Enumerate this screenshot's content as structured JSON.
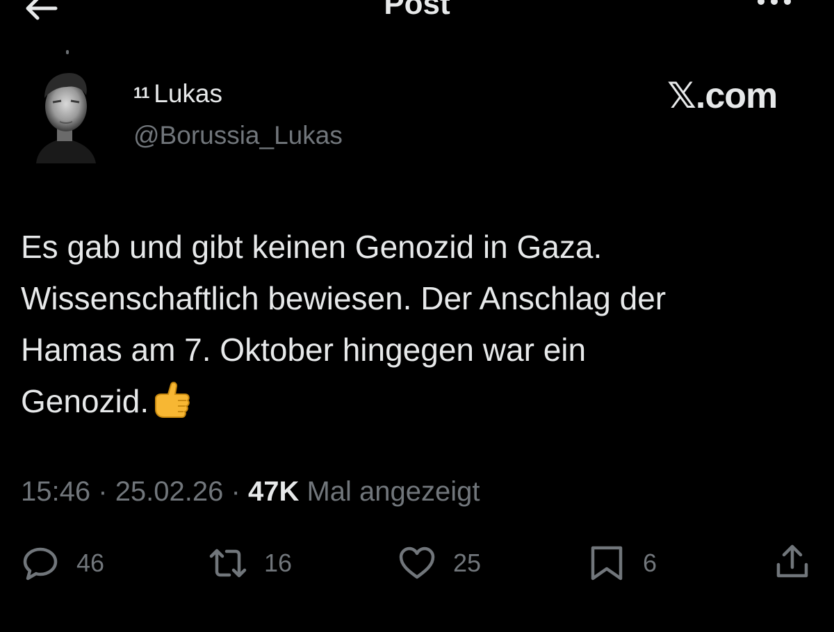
{
  "header": {
    "title": "Post"
  },
  "author": {
    "superscript": "11",
    "name": "Lukas",
    "handle": "@Borussia_Lukas"
  },
  "watermark": "𝕏.com",
  "post": {
    "lines": [
      "Es gab und gibt keinen Genozid in Gaza.",
      "Wissenschaftlich bewiesen. Der Anschlag der",
      "Hamas am 7. Oktober hingegen war ein",
      "Genozid."
    ],
    "emoji": "thumbs-up"
  },
  "meta": {
    "time": "15:46",
    "separator": "·",
    "date": "25.02.26",
    "views": "47K",
    "views_label": "Mal angezeigt"
  },
  "actions": {
    "replies": "46",
    "reposts": "16",
    "likes": "25",
    "bookmarks": "6"
  },
  "icons": {
    "back": "arrow-left-icon",
    "more": "more-horizontal-icon",
    "reply": "speech-bubble-icon",
    "repost": "repost-arrows-icon",
    "like": "heart-icon",
    "bookmark": "bookmark-icon",
    "share": "share-upload-icon"
  },
  "colors": {
    "background": "#000000",
    "text": "#e7e9ea",
    "muted": "#71767b"
  }
}
